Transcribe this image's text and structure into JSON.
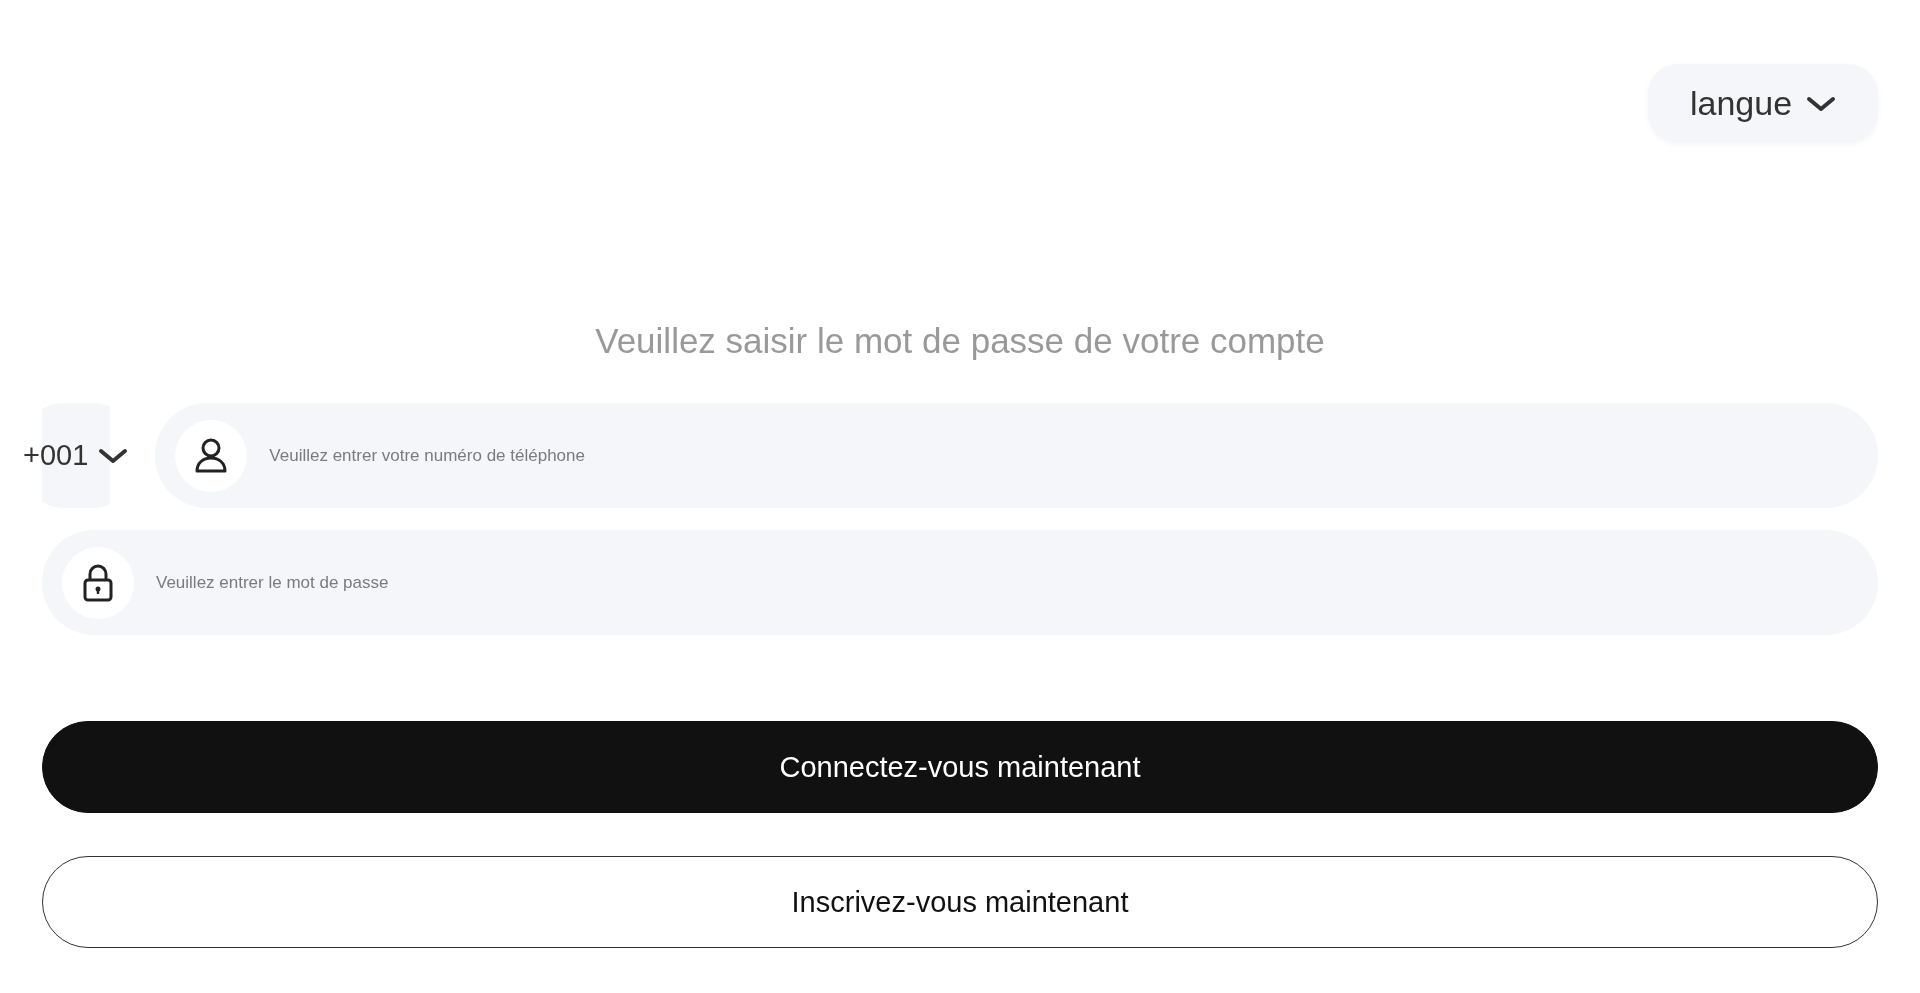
{
  "language_button": {
    "label": "langue"
  },
  "title": "Veuillez saisir le mot de passe de votre compte",
  "phone": {
    "country_code": "+001",
    "placeholder": "Veuillez entrer votre numéro de téléphone"
  },
  "password": {
    "placeholder": "Veuillez entrer le mot de passe"
  },
  "buttons": [
    {
      "label": "Connectez-vous maintenant",
      "kind": "primary"
    },
    {
      "label": "Inscrivez-vous maintenant",
      "kind": "outline"
    }
  ]
}
